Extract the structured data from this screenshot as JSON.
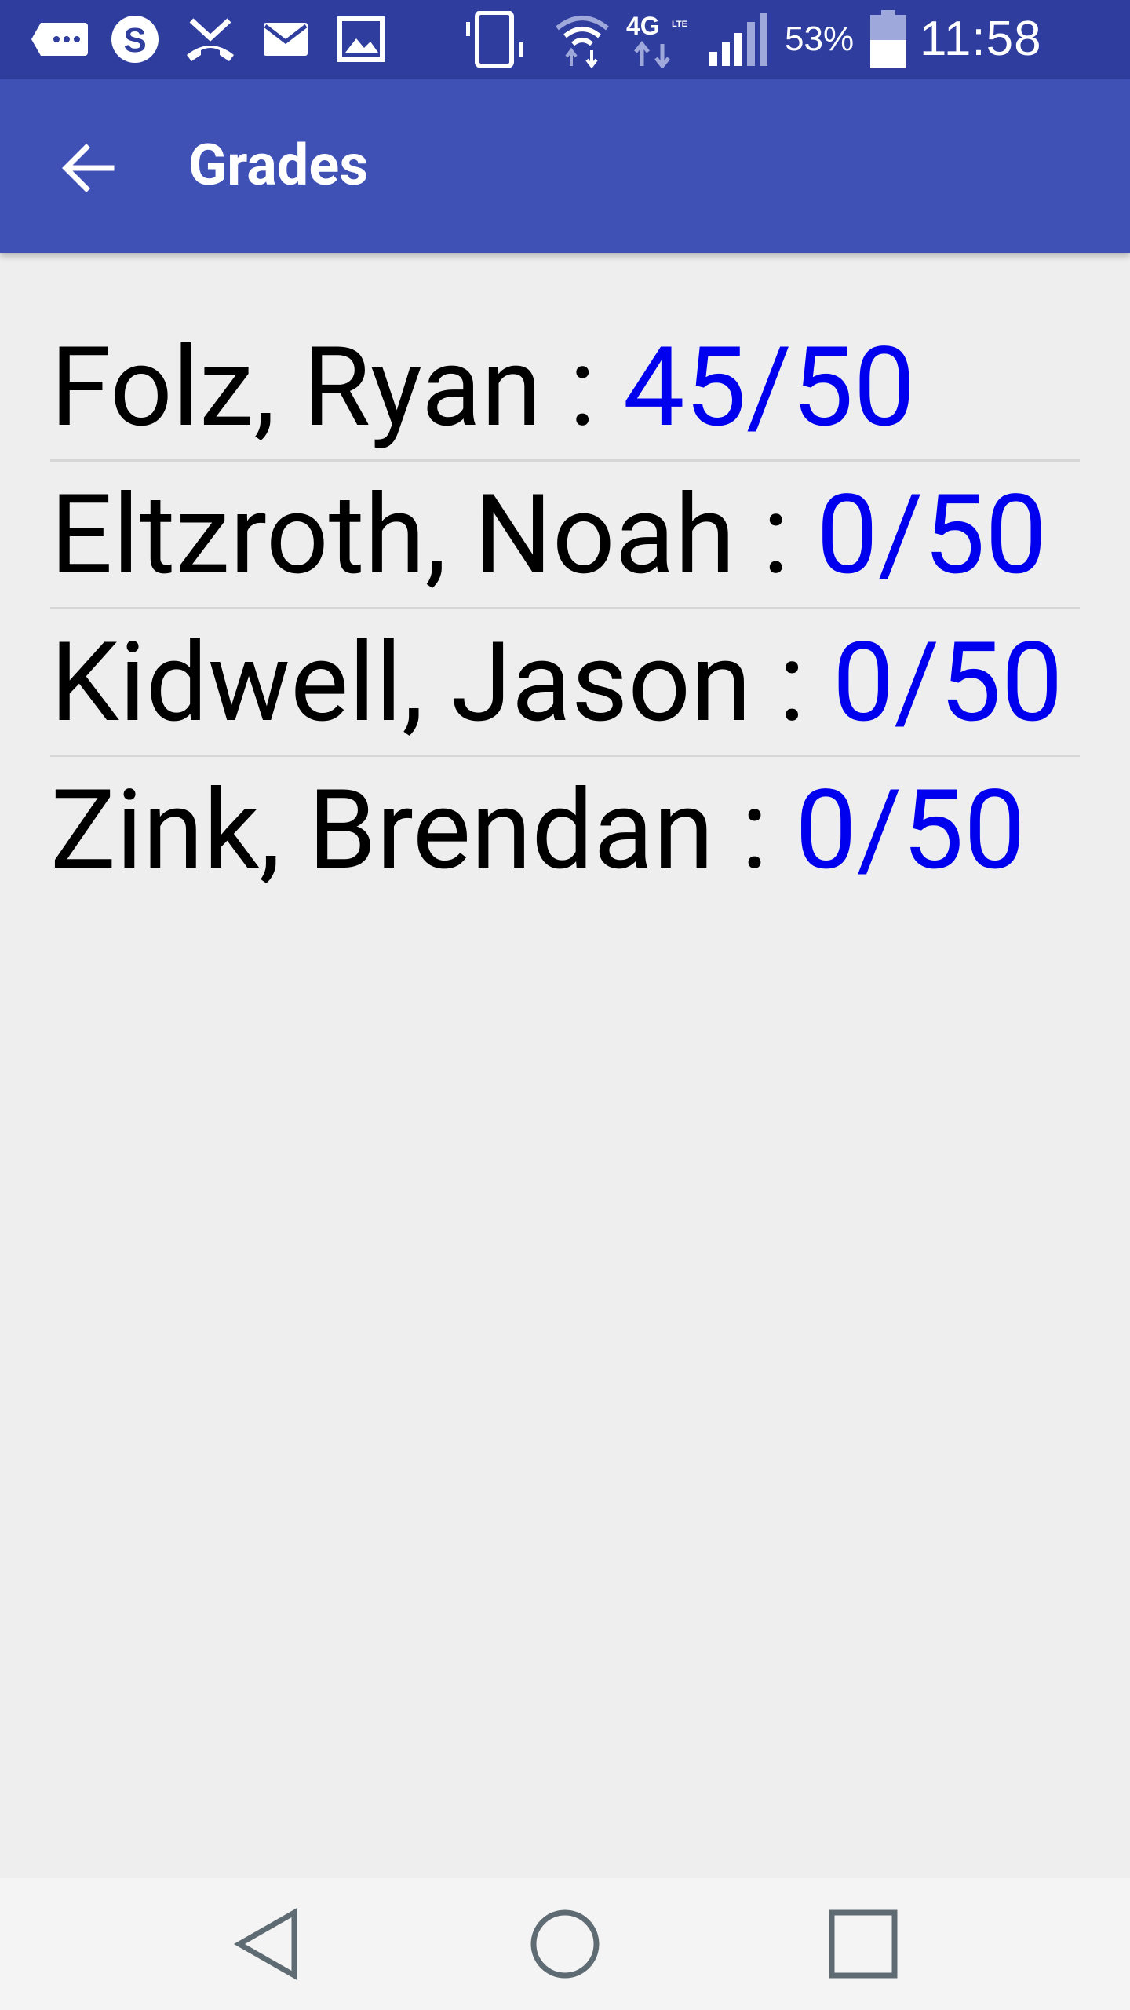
{
  "status_bar": {
    "battery_percent": "53%",
    "time": "11:58 PM",
    "icons": [
      "message-icon",
      "skype-icon",
      "missed-call-icon",
      "email-icon",
      "image-icon",
      "vibrate-icon",
      "wifi-icon",
      "4g-lte-icon",
      "signal-icon",
      "battery-icon"
    ]
  },
  "app_bar": {
    "title": "Grades",
    "back_icon": "arrow-back-icon"
  },
  "grades": [
    {
      "name": "Folz, Ryan",
      "separator": " : ",
      "score": "45/50"
    },
    {
      "name": "Eltzroth, Noah",
      "separator": " : ",
      "score": "0/50"
    },
    {
      "name": "Kidwell, Jason",
      "separator": " : ",
      "score": "0/50"
    },
    {
      "name": "Zink, Brendan",
      "separator": " : ",
      "score": "0/50"
    }
  ],
  "nav_bar": {
    "icons": [
      "nav-back-icon",
      "nav-home-icon",
      "nav-recents-icon"
    ]
  },
  "colors": {
    "status_bar": "#2F3E9E",
    "app_bar": "#3F51B5",
    "background": "#EEEEEE",
    "score": "#0000EE",
    "name": "#000000",
    "divider": "#D6D6D6",
    "nav_bar": "#F4F4F4",
    "nav_icon": "#5F6B73"
  }
}
